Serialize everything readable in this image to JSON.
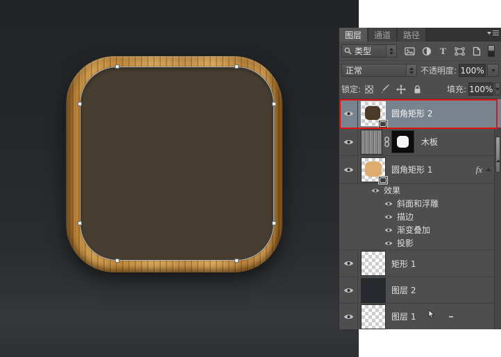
{
  "canvas": {
    "background_top": "#222426",
    "background_bottom": "#2e3033",
    "icon": {
      "wood_light": "#d8a85c",
      "wood_dark": "#7d5016",
      "inner_fill": "#473e31",
      "selection_outline": "#d7dce2",
      "handle_fill": "#eef0f2"
    }
  },
  "panel": {
    "tabs": {
      "items": [
        {
          "label": "图层",
          "active": true
        },
        {
          "label": "通道",
          "active": false
        },
        {
          "label": "路径",
          "active": false
        }
      ]
    },
    "filter": {
      "kind_label": "类型"
    },
    "blend": {
      "mode": "正常",
      "opacity_label": "不透明度:",
      "opacity_value": "100%"
    },
    "lock": {
      "label": "锁定:",
      "fill_label": "填充:",
      "fill_value": "100%"
    },
    "layers": {
      "selected_highlight": "#78838e",
      "red_outline": "#e31212",
      "rows": [
        {
          "name": "圆角矩形 2",
          "selected": true
        },
        {
          "name": "木板"
        },
        {
          "name": "圆角矩形 1",
          "fx_label": "fx"
        },
        {
          "effects_label": "效果",
          "effects": [
            "斜面和浮雕",
            "描边",
            "渐变叠加",
            "投影"
          ]
        },
        {
          "name": "矩形 1"
        },
        {
          "name": "图层 2"
        },
        {
          "name": "图层 1"
        }
      ]
    },
    "icons": [
      "search-icon",
      "filter-image-icon",
      "filter-adjustment-icon",
      "filter-type-icon",
      "filter-shape-icon",
      "filter-smart-object-icon",
      "filter-toggle",
      "lock-transparency-icon",
      "lock-pixels-icon",
      "lock-position-icon",
      "lock-all-icon",
      "eye-icon",
      "chain-link-icon",
      "fx-badge",
      "panel-menu-icon"
    ]
  }
}
